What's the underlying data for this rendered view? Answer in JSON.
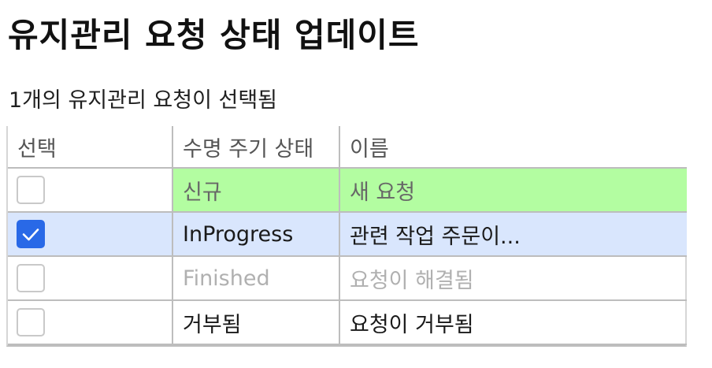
{
  "page": {
    "title": "유지관리 요청 상태 업데이트",
    "selection_text": "1개의 유지관리 요청이 선택됨"
  },
  "table": {
    "headers": {
      "select": "선택",
      "lifecycle_state": "수명 주기 상태",
      "name": "이름"
    },
    "rows": [
      {
        "selected": false,
        "state": "신규",
        "name": "새 요청",
        "row_color": "#b3fda1"
      },
      {
        "selected": true,
        "state": "InProgress",
        "name": "관련 작업 주문이...",
        "row_color": "#d9e6fd"
      },
      {
        "selected": false,
        "state": "Finished",
        "name": "요청이 해결됨",
        "text_color": "#b0b0b0"
      },
      {
        "selected": false,
        "state": "거부됨",
        "name": "요청이 거부됨"
      }
    ]
  },
  "icons": {
    "checked_checkbox": "check-icon",
    "unchecked_checkbox": "checkbox-icon"
  },
  "colors": {
    "new_row": "#b3fda1",
    "selected_row": "#d9e6fd",
    "checkbox_checked": "#2969e7",
    "disabled_text": "#b0b0b0"
  }
}
